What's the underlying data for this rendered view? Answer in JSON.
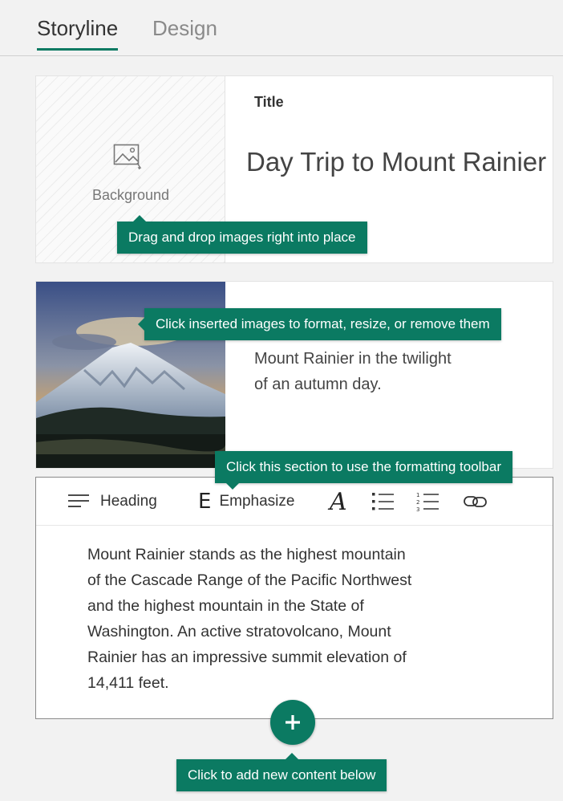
{
  "tabs": [
    {
      "label": "Storyline",
      "active": true
    },
    {
      "label": "Design",
      "active": false
    }
  ],
  "title_card": {
    "background_label": "Background",
    "title_label": "Title",
    "title_text": "Day Trip to Mount Rainier"
  },
  "tooltips": {
    "drag_drop": "Drag and drop images right into place",
    "inserted_images": "Click inserted images to format, resize, or remove them",
    "formatting_toolbar": "Click this section to use the formatting toolbar",
    "add_content": "Click to add new content below"
  },
  "image_card": {
    "caption_line1": "Mount Rainier in the twilight",
    "caption_line2": "of an autumn day."
  },
  "toolbar": {
    "heading_label": "Heading",
    "emphasize_label": "Emphasize",
    "icons": [
      "heading-icon",
      "emphasize-icon",
      "font-style-icon",
      "bulleted-list-icon",
      "numbered-list-icon",
      "link-icon"
    ]
  },
  "text_section": {
    "lines": [
      "Mount Rainier stands as the highest mountain",
      "of the Cascade Range of the Pacific Northwest",
      "and the highest mountain in the State of",
      "Washington. An active stratovolcano, Mount",
      "Rainier has an impressive summit elevation of",
      "14,411 feet."
    ]
  },
  "colors": {
    "accent": "#0b7a62",
    "background": "#f2f2f2"
  }
}
